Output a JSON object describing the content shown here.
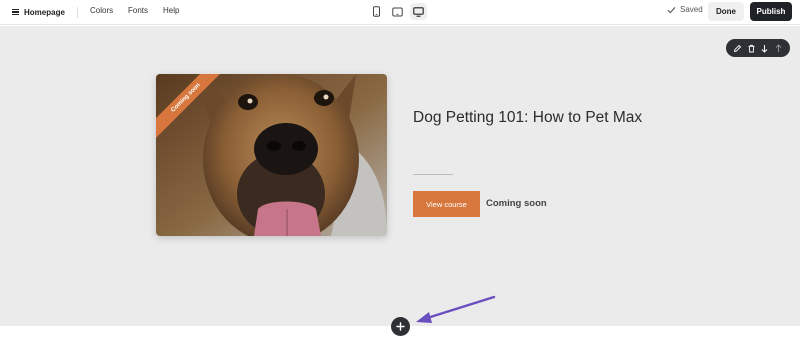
{
  "topbar": {
    "page_menu_label": "Homepage",
    "nav": [
      "Colors",
      "Fonts",
      "Help"
    ],
    "devices": [
      {
        "icon": "mobile-icon",
        "active": false
      },
      {
        "icon": "tablet-icon",
        "active": false
      },
      {
        "icon": "desktop-icon",
        "active": true
      }
    ],
    "status": "Saved",
    "done_label": "Done",
    "publish_label": "Publish"
  },
  "section_toolbar": {
    "icons": [
      "edit-icon",
      "delete-icon",
      "move-down-icon",
      "move-up-icon"
    ]
  },
  "course": {
    "ribbon": "Coming soon",
    "title": "Dog Petting 101: How to Pet Max",
    "button_label": "View course",
    "status": "Coming soon"
  },
  "colors": {
    "accent": "#d8773d",
    "dark": "#1f2328",
    "canvas": "#ebebeb",
    "annotation_arrow": "#6a4fc1"
  }
}
